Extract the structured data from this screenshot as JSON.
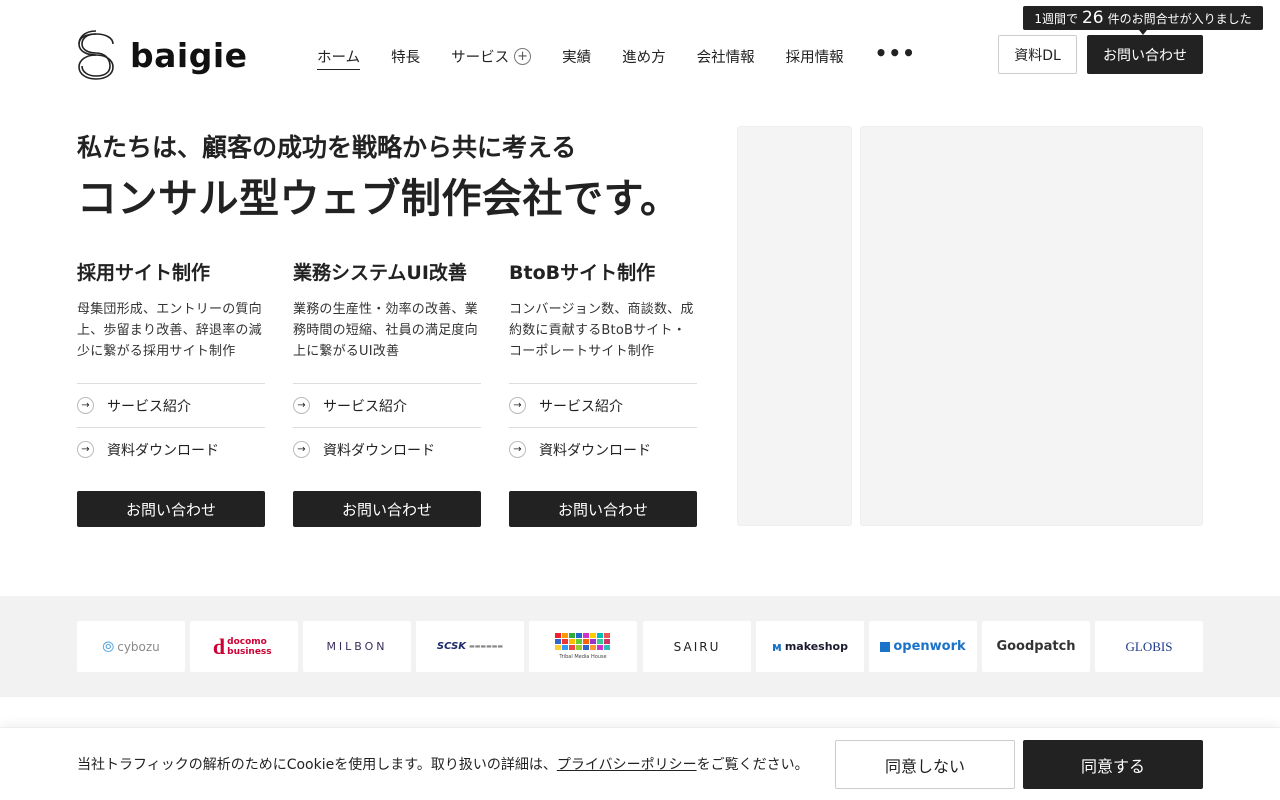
{
  "header": {
    "logo_text": "baigie",
    "nav": [
      {
        "label": "ホーム",
        "active": true
      },
      {
        "label": "特長"
      },
      {
        "label": "サービス",
        "has_plus": true
      },
      {
        "label": "実績"
      },
      {
        "label": "進め方"
      },
      {
        "label": "会社情報"
      },
      {
        "label": "採用情報"
      }
    ],
    "more_icon": "more-dots-icon",
    "download_label": "資料DL",
    "contact_label": "お問い合わせ",
    "notice": {
      "prefix": "1週間で",
      "count": "26",
      "suffix": "件のお問合せが入りました"
    }
  },
  "hero": {
    "subtitle": "私たちは、顧客の成功を戦略から共に考える",
    "title": "コンサル型ウェブ制作会社です。"
  },
  "services": [
    {
      "title": "採用サイト制作",
      "desc": "母集団形成、エントリーの質向上、歩留まり改善、辞退率の減少に繋がる採用サイト制作",
      "link1": "サービス紹介",
      "link2": "資料ダウンロード",
      "button": "お問い合わせ"
    },
    {
      "title": "業務システムUI改善",
      "desc": "業務の生産性・効率の改善、業務時間の短縮、社員の満足度向上に繋がるUI改善",
      "link1": "サービス紹介",
      "link2": "資料ダウンロード",
      "button": "お問い合わせ"
    },
    {
      "title": "BtoBサイト制作",
      "desc": "コンバージョン数、商談数、成約数に貢献するBtoBサイト・コーポレートサイト制作",
      "link1": "サービス紹介",
      "link2": "資料ダウンロード",
      "button": "お問い合わせ"
    }
  ],
  "client_logos": [
    {
      "text": "cybozu",
      "color": "#8a8a8a"
    },
    {
      "text": "docomo business",
      "color": "#cc0033"
    },
    {
      "text": "MILBON",
      "color": "#3a2c5a"
    },
    {
      "text": "SCSK",
      "color": "#1b2a6b"
    },
    {
      "text": "Tribal Media House",
      "color": "#444444"
    },
    {
      "text": "SAIRU",
      "color": "#222222"
    },
    {
      "text": "makeshop",
      "color": "#1a1a2e"
    },
    {
      "text": "openwork",
      "color": "#1a73c8"
    },
    {
      "text": "Goodpatch",
      "color": "#333333"
    },
    {
      "text": "GLOBIS",
      "color": "#1d3a8a"
    }
  ],
  "cookie": {
    "text_before": "当社トラフィックの解析のためにCookieを使用します。取り扱いの詳細は、",
    "link": "プライバシーポリシー",
    "text_after": "をご覧ください。",
    "deny": "同意しない",
    "accept": "同意する"
  }
}
